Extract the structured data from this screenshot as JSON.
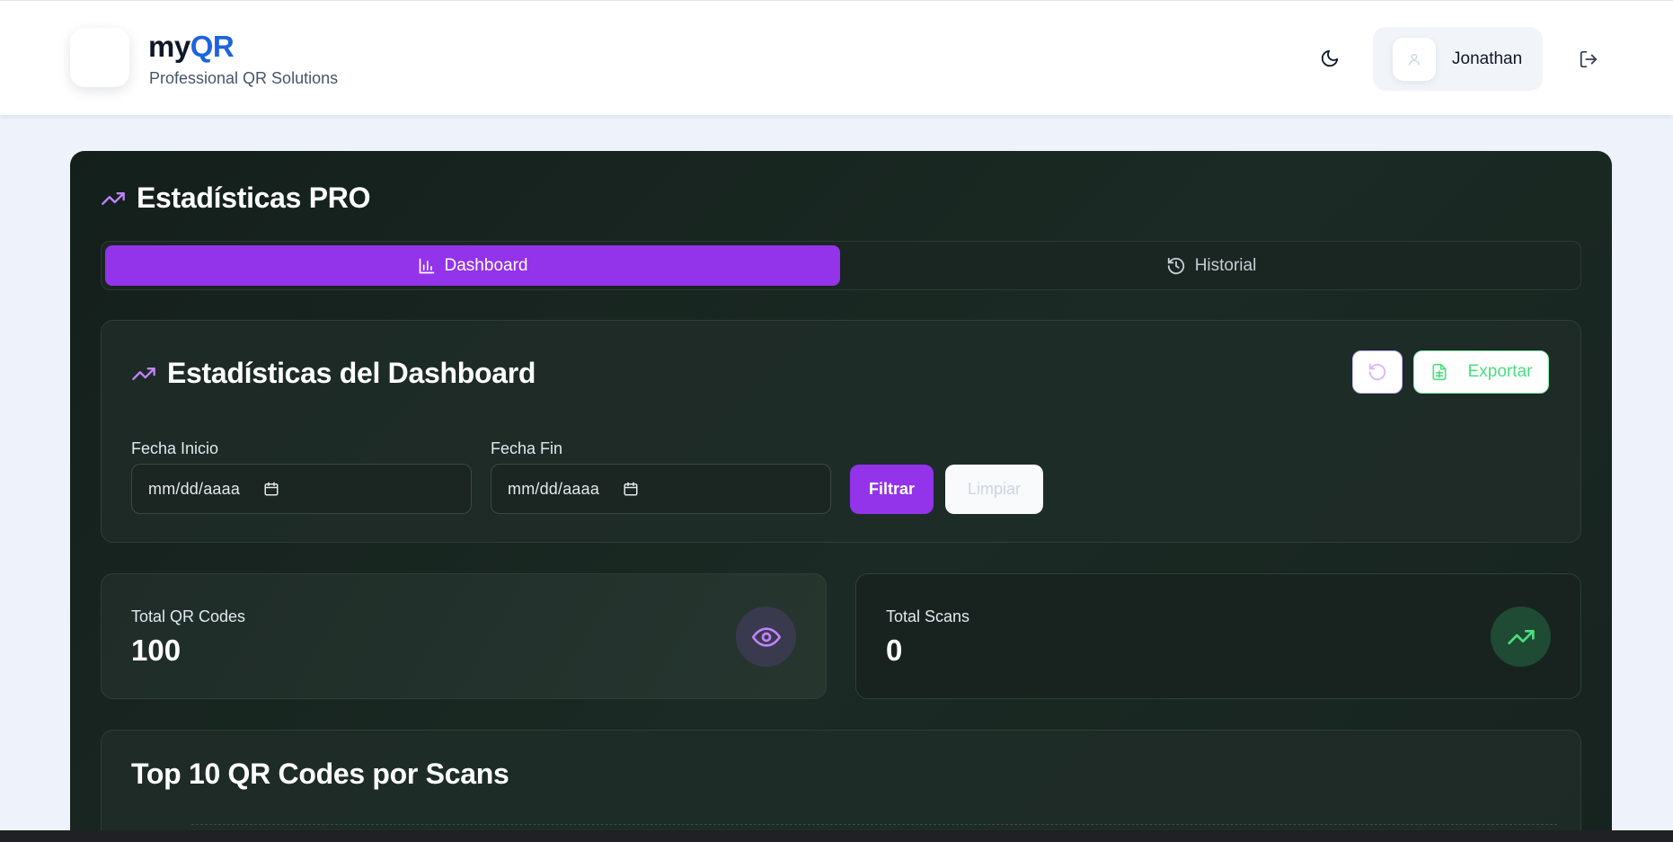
{
  "header": {
    "brand_prefix": "my",
    "brand_accent": "QR",
    "tagline": "Professional QR Solutions",
    "user_name": "Jonathan",
    "theme_icon": "moon-icon",
    "logout_icon": "logout-icon"
  },
  "panel": {
    "title": "Estadísticas PRO",
    "tabs": [
      {
        "label": "Dashboard",
        "icon": "bar-chart-icon",
        "active": true
      },
      {
        "label": "Historial",
        "icon": "history-icon",
        "active": false
      }
    ]
  },
  "dashboard": {
    "title": "Estadísticas del Dashboard",
    "export_label": "Exportar",
    "start_label": "Fecha Inicio",
    "end_label": "Fecha Fin",
    "start_placeholder": "mm/dd/aaaa",
    "end_placeholder": "mm/dd/aaaa",
    "filter_label": "Filtrar",
    "clear_label": "Limpiar"
  },
  "stats": {
    "total_qr_label": "Total QR Codes",
    "total_qr_value": "100",
    "total_scans_label": "Total Scans",
    "total_scans_value": "0"
  },
  "top10": {
    "title": "Top 10 QR Codes por Scans"
  },
  "colors": {
    "accent_purple": "#9333ea",
    "brand_blue": "#1d63e0",
    "success_green": "#4ade80",
    "panel_dark": "#17231f"
  }
}
